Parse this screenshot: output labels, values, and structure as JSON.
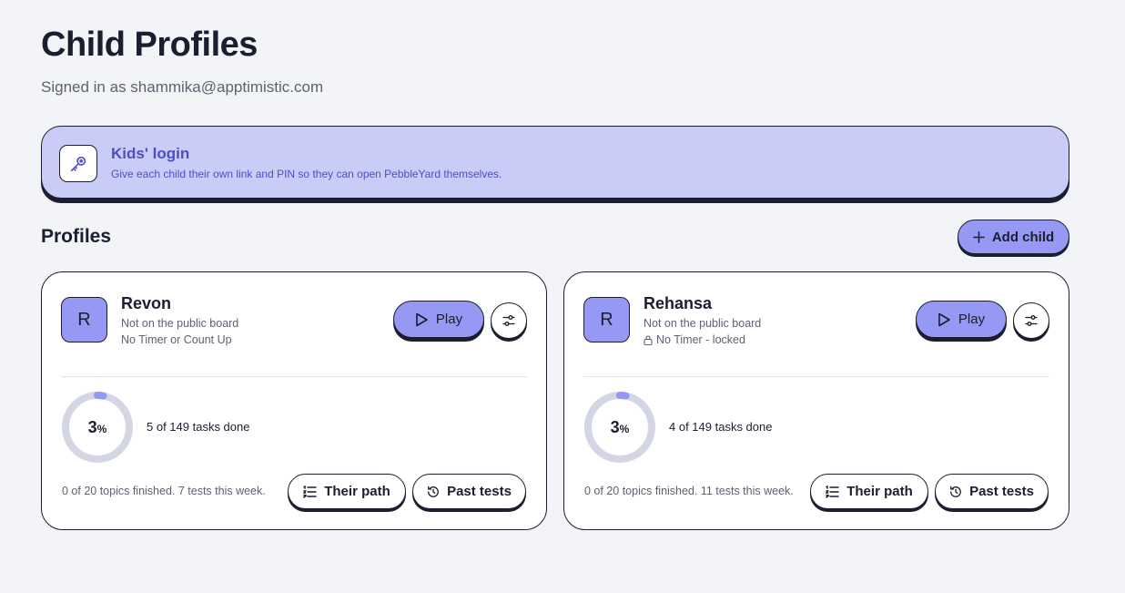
{
  "header": {
    "title": "Child Profiles",
    "subtitle": "Signed in as shammika@apptimistic.com"
  },
  "kids_login": {
    "title": "Kids' login",
    "description": "Give each child their own link and PIN so they can open PebbleYard themselves.",
    "icon": "key-icon"
  },
  "profiles_section": {
    "title": "Profiles",
    "add_child_label": "Add child"
  },
  "colors": {
    "accent": "#9599f4",
    "banner": "#c9ccf6",
    "banner_text": "#4a4fc4",
    "ring_track": "#d4d6e4",
    "ink": "#1c1d2e"
  },
  "children": [
    {
      "initial": "R",
      "name": "Revon",
      "board_status": "Not on the public board",
      "timer_status": "No Timer or Count Up",
      "timer_locked": false,
      "play_label": "Play",
      "progress_percent": 3,
      "progress_number": "3",
      "progress_suffix": "%",
      "tasks_done": "5 of 149 tasks done",
      "topics_summary": "0 of 20 topics finished. 7 tests this week.",
      "path_label": "Their path",
      "past_tests_label": "Past tests"
    },
    {
      "initial": "R",
      "name": "Rehansa",
      "board_status": "Not on the public board",
      "timer_status": "No Timer - locked",
      "timer_locked": true,
      "play_label": "Play",
      "progress_percent": 3,
      "progress_number": "3",
      "progress_suffix": "%",
      "tasks_done": "4 of 149 tasks done",
      "topics_summary": "0 of 20 topics finished. 11 tests this week.",
      "path_label": "Their path",
      "past_tests_label": "Past tests"
    }
  ]
}
